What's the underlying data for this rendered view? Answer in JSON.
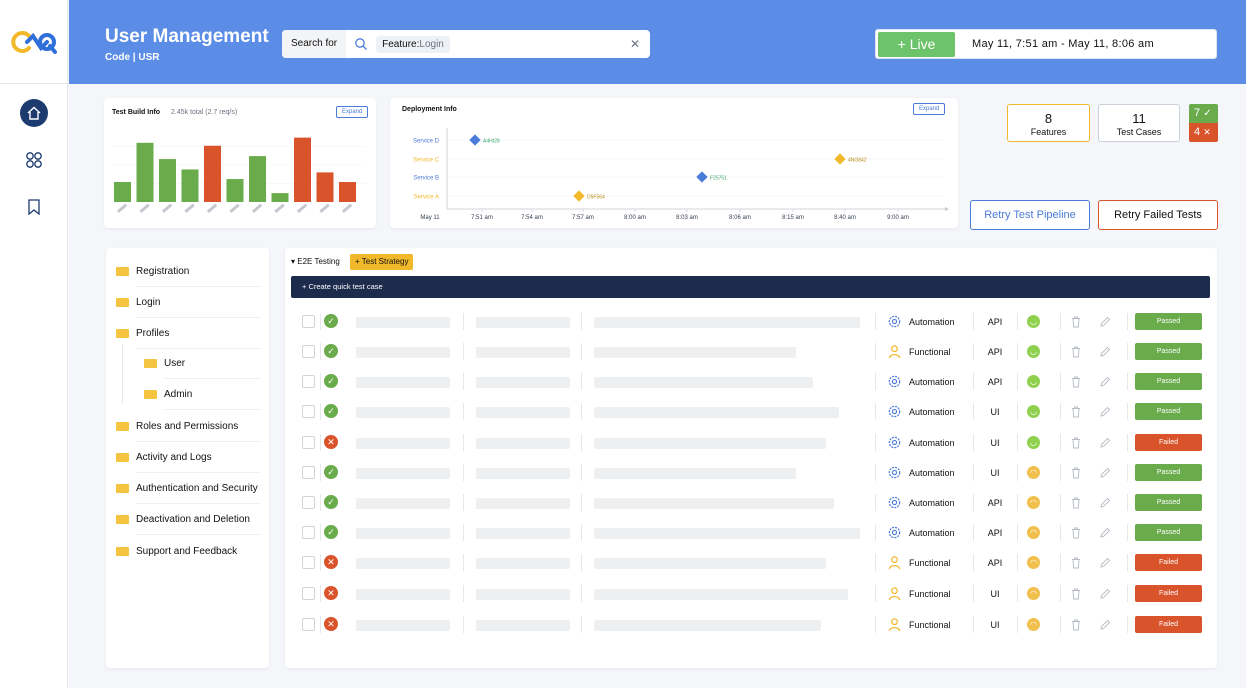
{
  "header": {
    "title": "User Management",
    "subtitle": "Code | USR",
    "search": {
      "label": "Search for",
      "chip_key": "Feature:",
      "chip_value": "Login",
      "clear": "✕"
    },
    "live": {
      "label": "+ Live",
      "range": "May 11, 7:51 am - May 11, 8:06 am"
    }
  },
  "sidebar": {
    "items": [
      {
        "name": "home-icon",
        "active": true
      },
      {
        "name": "modules-icon",
        "active": false
      },
      {
        "name": "bookmark-icon",
        "active": false
      }
    ]
  },
  "build_info": {
    "title": "Test Build Info",
    "meta": "2.45k total (2.7 req/s)",
    "expand": "Expand",
    "chart_data": {
      "type": "bar",
      "values": [
        0.27,
        0.8,
        0.58,
        0.44,
        0.76,
        0.31,
        0.62,
        0.12,
        0.87,
        0.4,
        0.27
      ],
      "status": [
        "pass",
        "pass",
        "pass",
        "pass",
        "fail",
        "pass",
        "pass",
        "pass",
        "fail",
        "fail",
        "fail"
      ],
      "colors": {
        "pass": "#6aab4c",
        "fail": "#d9532b"
      }
    }
  },
  "deployment": {
    "title": "Deployment Info",
    "expand": "Expand",
    "chart_data": {
      "type": "scatter",
      "y_categories": [
        "Service D",
        "Service C",
        "Service B",
        "Service A"
      ],
      "x_ticks": [
        "May 11",
        "7:51 am",
        "7:54 am",
        "7:57 am",
        "8:00 am",
        "8:03 am",
        "8:06 am",
        "8:15 am",
        "8:40 am",
        "9:00 am"
      ],
      "points": [
        {
          "service": "Service D",
          "x": "7:51 am",
          "id": "A4Ht28",
          "color": "#4b7bd9"
        },
        {
          "service": "Service C",
          "x": "8:40 am",
          "id": "4NG842",
          "color": "#f1b82a"
        },
        {
          "service": "Service B",
          "x": "8:06 am",
          "id": "F25751",
          "color": "#4b7bd9"
        },
        {
          "service": "Service A",
          "x": "7:57 am",
          "id": "D5F564",
          "color": "#f1b82a"
        }
      ],
      "label_colors": {
        "Service D": "#4b7bd9",
        "Service C": "#f1b82a",
        "Service B": "#4b7bd9",
        "Service A": "#f1b82a"
      }
    }
  },
  "stats": {
    "features": {
      "value": "8",
      "label": "Features"
    },
    "test_cases": {
      "value": "11",
      "label": "Test Cases"
    },
    "passed": {
      "value": "7",
      "mark": "✓"
    },
    "failed": {
      "value": "4",
      "mark": "✕"
    }
  },
  "actions": {
    "retry_pipeline": "Retry Test Pipeline",
    "retry_failed": "Retry Failed Tests"
  },
  "tree": {
    "items": [
      {
        "label": "Registration",
        "level": 0
      },
      {
        "label": "Login",
        "level": 0
      },
      {
        "label": "Profiles",
        "level": 0
      },
      {
        "label": "User",
        "level": 1
      },
      {
        "label": "Admin",
        "level": 1
      },
      {
        "label": "Roles and Permissions",
        "level": 0
      },
      {
        "label": "Activity and Logs",
        "level": 0
      },
      {
        "label": "Authentication and Security",
        "level": 0
      },
      {
        "label": "Deactivation and Deletion",
        "level": 0
      },
      {
        "label": "Support and Feedback",
        "level": 0
      }
    ]
  },
  "tests": {
    "tab": "▾ E2E Testing",
    "strategy": "+ Test Strategy",
    "quick_create": "+ Create quick test case",
    "rows": [
      {
        "status": "pass",
        "type": "Automation",
        "channel": "API",
        "mood": "happy",
        "result": "Passed"
      },
      {
        "status": "pass",
        "type": "Functional",
        "channel": "API",
        "mood": "happy",
        "result": "Passed"
      },
      {
        "status": "pass",
        "type": "Automation",
        "channel": "API",
        "mood": "happy",
        "result": "Passed"
      },
      {
        "status": "pass",
        "type": "Automation",
        "channel": "UI",
        "mood": "happy",
        "result": "Passed"
      },
      {
        "status": "fail",
        "type": "Automation",
        "channel": "UI",
        "mood": "happy",
        "result": "Failed"
      },
      {
        "status": "pass",
        "type": "Automation",
        "channel": "UI",
        "mood": "sad",
        "result": "Passed"
      },
      {
        "status": "pass",
        "type": "Automation",
        "channel": "API",
        "mood": "sad",
        "result": "Passed"
      },
      {
        "status": "pass",
        "type": "Automation",
        "channel": "API",
        "mood": "sad",
        "result": "Passed"
      },
      {
        "status": "fail",
        "type": "Functional",
        "channel": "API",
        "mood": "sad",
        "result": "Failed"
      },
      {
        "status": "fail",
        "type": "Functional",
        "channel": "UI",
        "mood": "sad",
        "result": "Failed"
      },
      {
        "status": "fail",
        "type": "Functional",
        "channel": "UI",
        "mood": "sad",
        "result": "Failed"
      }
    ]
  },
  "colors": {
    "header": "#5b8ce6",
    "pass": "#6aab4c",
    "fail": "#d9532b",
    "accent": "#4b7bd9",
    "warning": "#f1b82a",
    "navy": "#1d2b4d"
  }
}
